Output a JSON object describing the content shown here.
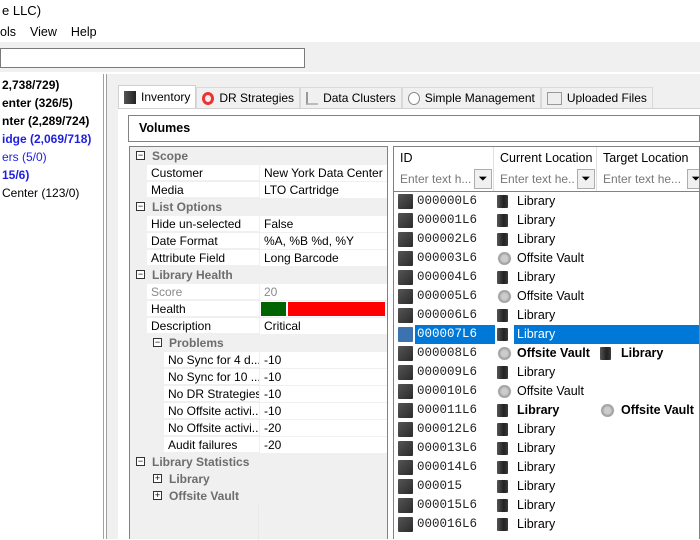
{
  "window": {
    "title": "e LLC)"
  },
  "menu": [
    "ols",
    "View",
    "Help"
  ],
  "tree": [
    {
      "label": "2,738/729)",
      "bold": true,
      "blue": false
    },
    {
      "label": "enter (326/5)",
      "bold": true,
      "blue": false
    },
    {
      "label": "nter (2,289/724)",
      "bold": true,
      "blue": false
    },
    {
      "label": "idge (2,069/718)",
      "bold": true,
      "blue": true
    },
    {
      "label": "ers (5/0)",
      "bold": false,
      "blue": true
    },
    {
      "label": "15/6)",
      "bold": true,
      "blue": true
    },
    {
      "label": "Center (123/0)",
      "bold": false,
      "blue": false
    }
  ],
  "tabs": [
    {
      "label": "Inventory",
      "icon": "library-icon",
      "active": true
    },
    {
      "label": "DR Strategies",
      "icon": "lifebuoy-icon",
      "active": false
    },
    {
      "label": "Data Clusters",
      "icon": "cluster-icon",
      "active": false
    },
    {
      "label": "Simple Management",
      "icon": "clock-icon",
      "active": false
    },
    {
      "label": "Uploaded Files",
      "icon": "window-icon",
      "active": false
    }
  ],
  "volumes_header": "Volumes",
  "properties": [
    {
      "type": "cat",
      "label": "Scope",
      "level": 0
    },
    {
      "type": "prop",
      "label": "Customer",
      "value": "New York Data Center",
      "level": 0
    },
    {
      "type": "prop",
      "label": "Media",
      "value": "LTO Cartridge",
      "level": 0
    },
    {
      "type": "cat",
      "label": "List Options",
      "level": 0
    },
    {
      "type": "prop",
      "label": "Hide un-selected",
      "value": "False",
      "level": 0
    },
    {
      "type": "prop",
      "label": "Date Format",
      "value": "%A, %B %d, %Y",
      "level": 0
    },
    {
      "type": "prop",
      "label": "Attribute Field",
      "value": "Long Barcode",
      "level": 0
    },
    {
      "type": "cat",
      "label": "Library Health",
      "level": 0
    },
    {
      "type": "prop",
      "label": "Score",
      "value": "20",
      "level": 0,
      "disabled": true
    },
    {
      "type": "health",
      "label": "Health",
      "score_percent": 20,
      "good_color": "#006400",
      "bad_color": "#ff0000",
      "level": 0
    },
    {
      "type": "prop",
      "label": "Description",
      "value": "Critical",
      "level": 0
    },
    {
      "type": "cat",
      "label": "Problems",
      "level": 1
    },
    {
      "type": "prop",
      "label": "No Sync for 4 d...",
      "value": "-10",
      "level": 1
    },
    {
      "type": "prop",
      "label": "No Sync for 10 ...",
      "value": "-10",
      "level": 1
    },
    {
      "type": "prop",
      "label": "No DR Strategies",
      "value": "-10",
      "level": 1
    },
    {
      "type": "prop",
      "label": "No Offsite activi...",
      "value": "-10",
      "level": 1
    },
    {
      "type": "prop",
      "label": "No Offsite activi...",
      "value": "-20",
      "level": 1
    },
    {
      "type": "prop",
      "label": "Audit failures",
      "value": "-20",
      "level": 1
    },
    {
      "type": "cat",
      "label": "Library Statistics",
      "level": 0
    },
    {
      "type": "cat",
      "label": "Library",
      "level": 1,
      "collapsed": true
    },
    {
      "type": "cat",
      "label": "Offsite Vault",
      "level": 1,
      "collapsed": true
    }
  ],
  "list": {
    "columns": [
      {
        "label": "ID",
        "filter_placeholder": "Enter text h..."
      },
      {
        "label": "Current Location",
        "filter_placeholder": "Enter text he..."
      },
      {
        "label": "Target Location",
        "filter_placeholder": "Enter text he..."
      }
    ],
    "selection_color": "#0078d7",
    "rows": [
      {
        "id": "000000L6",
        "current": "Library"
      },
      {
        "id": "000001L6",
        "current": "Library"
      },
      {
        "id": "000002L6",
        "current": "Library"
      },
      {
        "id": "000003L6",
        "current": "Offsite Vault"
      },
      {
        "id": "000004L6",
        "current": "Library"
      },
      {
        "id": "000005L6",
        "current": "Offsite Vault"
      },
      {
        "id": "000006L6",
        "current": "Library"
      },
      {
        "id": "000007L6",
        "current": "Library",
        "selected": true
      },
      {
        "id": "000008L6",
        "current": "Offsite Vault",
        "target": "Library"
      },
      {
        "id": "000009L6",
        "current": "Library"
      },
      {
        "id": "000010L6",
        "current": "Offsite Vault"
      },
      {
        "id": "000011L6",
        "current": "Library",
        "target": "Offsite Vault"
      },
      {
        "id": "000012L6",
        "current": "Library"
      },
      {
        "id": "000013L6",
        "current": "Library"
      },
      {
        "id": "000014L6",
        "current": "Library"
      },
      {
        "id": "000015",
        "current": "Library"
      },
      {
        "id": "000015L6",
        "current": "Library"
      },
      {
        "id": "000016L6",
        "current": "Library"
      }
    ]
  }
}
